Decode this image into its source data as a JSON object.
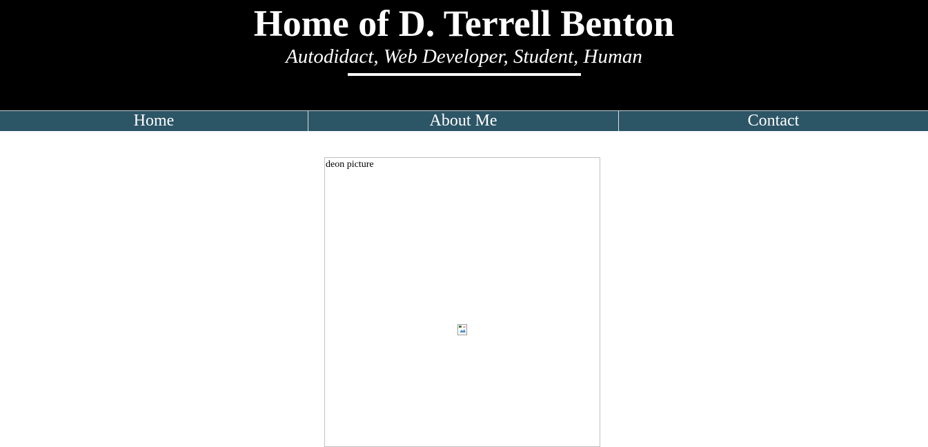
{
  "header": {
    "title": "Home of D. Terrell Benton",
    "subtitle": "Autodidact, Web Developer, Student, Human"
  },
  "nav": {
    "items": [
      {
        "label": "Home"
      },
      {
        "label": "About Me"
      },
      {
        "label": "Contact"
      }
    ]
  },
  "main": {
    "photo_alt": "deon picture",
    "broken_icon": "broken-image-icon"
  },
  "colors": {
    "header_bg": "#000000",
    "nav_bg": "#2c5566",
    "text_light": "#ffffff"
  }
}
